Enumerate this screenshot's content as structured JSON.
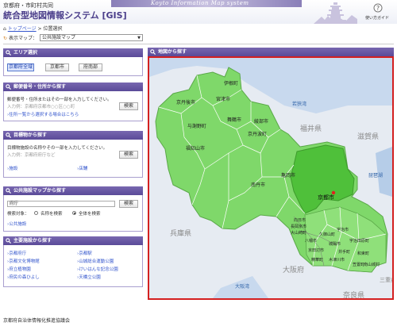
{
  "header": {
    "org": "京都府・市町村共同",
    "title": "統合型地図情報システム [GIS]",
    "banner": "Koyto Information Map system",
    "help_label": "使い方ガイド"
  },
  "breadcrumb": {
    "home": "トップページ",
    "sep": " > ",
    "current": "位置選択"
  },
  "map_select": {
    "label": "表示マップ：",
    "value": "公共施設マップ"
  },
  "area_panel": {
    "title": "エリア選択",
    "buttons": [
      "京都府全域",
      "京都市",
      "府南部"
    ],
    "active": 0
  },
  "postal_panel": {
    "title": "郵便番号・住所から探す",
    "desc": "郵便番号・住所またはその一部を入力してください。",
    "placeholder": "入力例：京都府京都市○○区○○町",
    "search": "検索",
    "link": "住所一覧から選択する場合はこちら"
  },
  "landmark_panel": {
    "title": "目標物から探す",
    "desc": "目標物施設の名称やその一部を入力してください。",
    "placeholder": "入力例：京都府府庁など",
    "search": "検索",
    "links": [
      "施設",
      "店舗"
    ]
  },
  "facility_panel": {
    "title": "公共施設マップから探す",
    "input_value": "府庁",
    "search": "検索",
    "target_label": "検索対象：",
    "radio_name": "名称を検索",
    "radio_all": "全体を検索",
    "selected": "all",
    "link": "公共施設"
  },
  "main_panel": {
    "title": "主要施設から探す",
    "links": [
      "京都府庁",
      "京都駅",
      "京都文化博物館",
      "山城総合運動公園",
      "府立植物園",
      "けいはんな記念公園",
      "府民の森ひよし",
      "天橋立公園"
    ]
  },
  "map": {
    "title": "地図から探す",
    "labels": {
      "iwakiya": "伊根町",
      "kyotango": "京丹後市",
      "miyazu": "宮津市",
      "yosano": "与謝野町",
      "ayabe": "舞鶴市",
      "maizuru": "綾部市",
      "fukuchiyama": "福知山市",
      "kyotamba": "京丹波町",
      "nantan": "南丹市",
      "kameoka": "亀岡市",
      "kyoto": "京都市",
      "wakasa": "若狭湾",
      "fukui": "福井県",
      "shiga": "滋賀県",
      "hyogo": "兵庫県",
      "osaka": "大阪府",
      "nara": "奈良県",
      "biwa": "琵琶湖",
      "osakawan": "大阪湾",
      "mie": "三重県",
      "muko": "向日市",
      "nagaokakyo": "長岡京市",
      "oyamazaki": "大山崎町",
      "uji": "宇治市",
      "joyo": "城陽市",
      "kumiyama": "久御山町",
      "yawata": "八幡市",
      "kyotanabe": "京田辺市",
      "ide": "井手町",
      "ujitawara": "宇治田原町",
      "seika": "精華町",
      "kizugawa": "木津川市",
      "wazuka": "和束町",
      "minamiyamashiro": "南山城村",
      "kasagi": "笠置町"
    }
  },
  "footer": {
    "text": "京都府自治体情報化推進協議会"
  }
}
